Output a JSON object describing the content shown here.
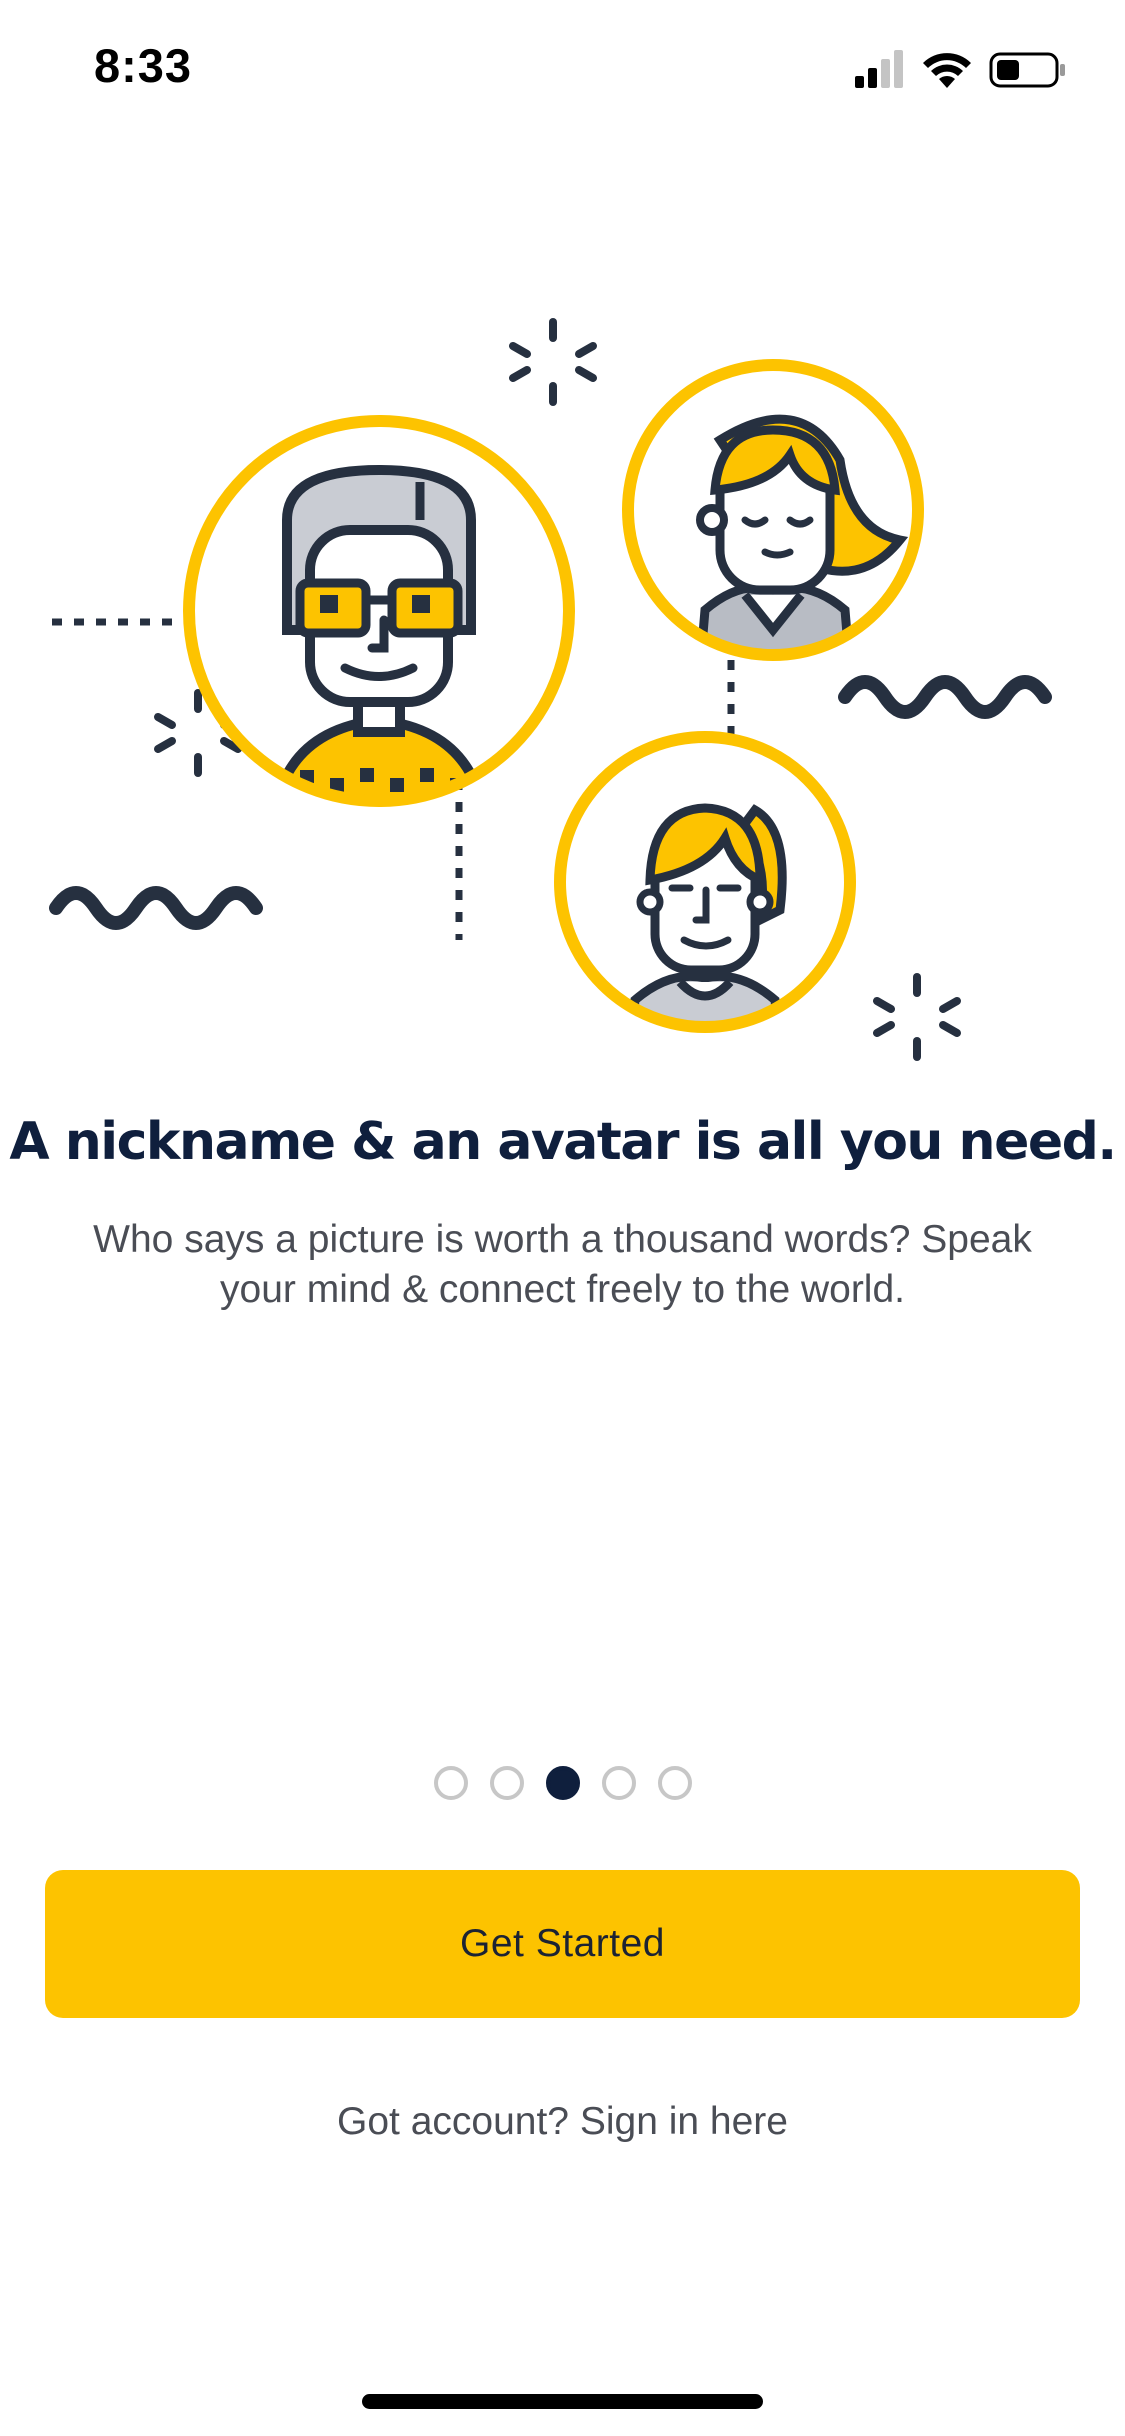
{
  "status_bar": {
    "time": "8:33",
    "icons": [
      "cellular-signal-icon",
      "wifi-icon",
      "battery-icon"
    ]
  },
  "illustration": {
    "icons": [
      "man-avatar-icon",
      "woman-avatar-icon",
      "girl-avatar-icon",
      "sparkle-icon",
      "squiggle-icon"
    ],
    "colors": {
      "accent": "#fdc300",
      "ink": "#263040"
    }
  },
  "onboarding": {
    "headline": "A nickname & an avatar is all you need.",
    "subtitle_line1": "Who says a picture is worth a thousand words? Speak",
    "subtitle_line2": "your mind & connect freely to the world.",
    "page_count": 5,
    "current_page": 3
  },
  "actions": {
    "primary_label": "Get Started",
    "secondary_label": "Got account? Sign in here"
  },
  "colors": {
    "primary": "#fdc300",
    "headline": "#0f1f3d",
    "body_text": "#4a4d55",
    "dot_active": "#0f1f3d",
    "dot_inactive": "#c7c7c7"
  }
}
